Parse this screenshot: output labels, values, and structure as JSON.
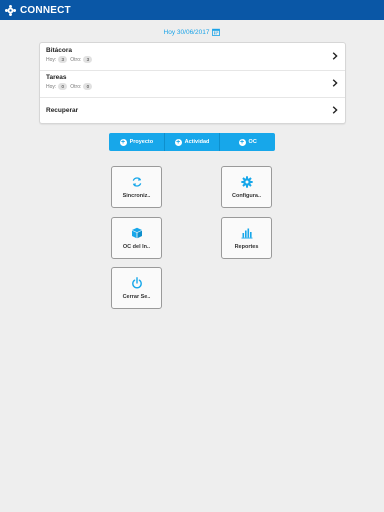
{
  "header": {
    "app_name": "CONNECT",
    "logo_icon": "gear-logo-icon"
  },
  "date": {
    "text": "Hoy 30/06/2017",
    "icon": "calendar-icon"
  },
  "summary": {
    "rows": [
      {
        "title": "Bitácora",
        "hoy_label": "Hoy:",
        "hoy_value": "3",
        "otros_label": "Otro:",
        "otros_value": "3"
      },
      {
        "title": "Tareas",
        "hoy_label": "Hoy:",
        "hoy_value": "0",
        "otros_label": "Otro:",
        "otros_value": "0"
      },
      {
        "title": "Recuperar"
      }
    ]
  },
  "actions": {
    "proyecto": "Proyecto",
    "actividad": "Actividad",
    "oc": "OC"
  },
  "tiles": {
    "sincronizar": "Sincroniz..",
    "configuracion": "Configura..",
    "oc_inventario": "OC del In..",
    "reportes": "Reportes",
    "cerrar_sesion": "Cerrar Se.."
  },
  "colors": {
    "header": "#0a57a6",
    "accent": "#17a7ea",
    "background": "#eeeeee"
  }
}
